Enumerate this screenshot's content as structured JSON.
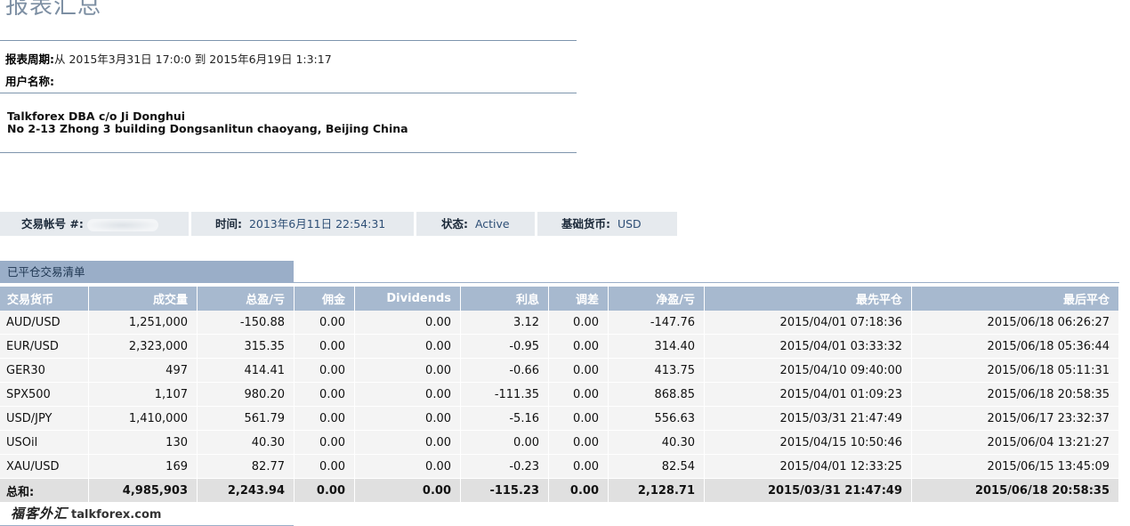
{
  "title": "报表汇总",
  "period": {
    "label": "报表周期:",
    "value": "从 2015年3月31日 17:0:0 到 2015年6月19日 1:3:17"
  },
  "username": {
    "label": "用户名称:",
    "value": ""
  },
  "address": {
    "line1": "Talkforex DBA c/o Ji Donghui",
    "line2": "No 2-13 Zhong 3 building Dongsanlitun chaoyang, Beijing China"
  },
  "account_info": {
    "account_label": "交易帐号 #:",
    "time_label": "时间:",
    "time_value": "2013年6月11日 22:54:31",
    "status_label": "状态:",
    "status_value": "Active",
    "currency_label": "基础货币:",
    "currency_value": "USD"
  },
  "section_title": "已平仓交易清单",
  "table": {
    "headers": [
      "交易货币",
      "成交量",
      "总盈/亏",
      "佣金",
      "Dividends",
      "利息",
      "调差",
      "净盈/亏",
      "最先平仓",
      "最后平仓"
    ],
    "rows": [
      [
        "AUD/USD",
        "1,251,000",
        "-150.88",
        "0.00",
        "0.00",
        "3.12",
        "0.00",
        "-147.76",
        "2015/04/01 07:18:36",
        "2015/06/18 06:26:27"
      ],
      [
        "EUR/USD",
        "2,323,000",
        "315.35",
        "0.00",
        "0.00",
        "-0.95",
        "0.00",
        "314.40",
        "2015/04/01 03:33:32",
        "2015/06/18 05:36:44"
      ],
      [
        "GER30",
        "497",
        "414.41",
        "0.00",
        "0.00",
        "-0.66",
        "0.00",
        "413.75",
        "2015/04/10 09:40:00",
        "2015/06/18 05:11:31"
      ],
      [
        "SPX500",
        "1,107",
        "980.20",
        "0.00",
        "0.00",
        "-111.35",
        "0.00",
        "868.85",
        "2015/04/01 01:09:23",
        "2015/06/18 20:58:35"
      ],
      [
        "USD/JPY",
        "1,410,000",
        "561.79",
        "0.00",
        "0.00",
        "-5.16",
        "0.00",
        "556.63",
        "2015/03/31 21:47:49",
        "2015/06/17 23:32:37"
      ],
      [
        "USOil",
        "130",
        "40.30",
        "0.00",
        "0.00",
        "0.00",
        "0.00",
        "40.30",
        "2015/04/15 10:50:46",
        "2015/06/04 13:21:27"
      ],
      [
        "XAU/USD",
        "169",
        "82.77",
        "0.00",
        "0.00",
        "-0.23",
        "0.00",
        "82.54",
        "2015/04/01 12:33:25",
        "2015/06/15 13:45:09"
      ]
    ],
    "total": [
      "总和:",
      "4,985,903",
      "2,243.94",
      "0.00",
      "0.00",
      "-115.23",
      "0.00",
      "2,128.71",
      "2015/03/31 21:47:49",
      "2015/06/18 20:58:35"
    ]
  },
  "watermark": {
    "cn": "福客外汇",
    "en": "talkforex.com"
  }
}
